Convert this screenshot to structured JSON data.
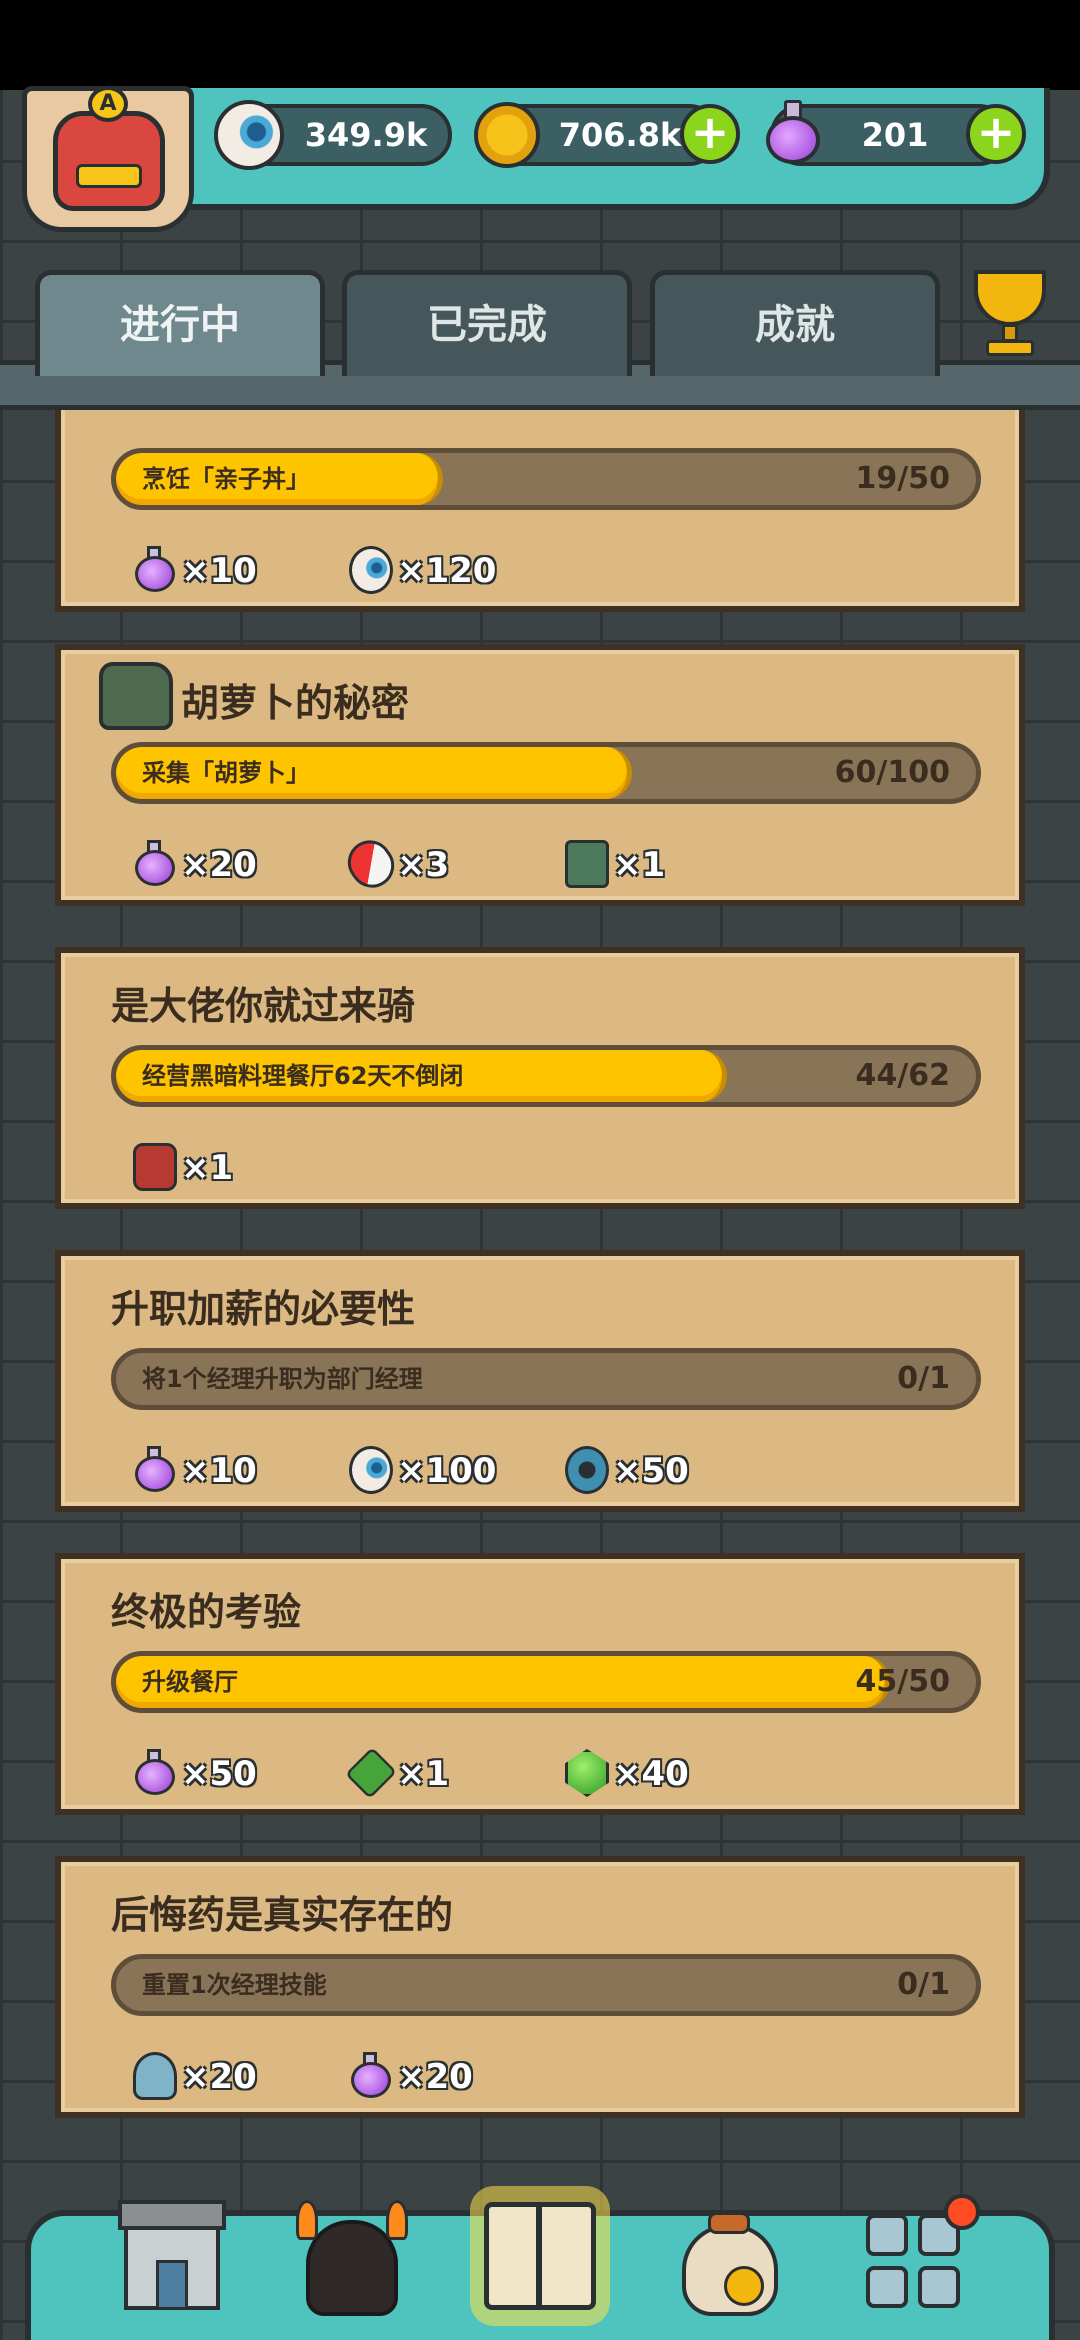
{
  "currency": {
    "eyes": "349.9k",
    "coins": "706.8k",
    "potions": "201",
    "add_symbol": "+"
  },
  "badge_letter": "A",
  "tabs": [
    {
      "label": "进行中",
      "active": true
    },
    {
      "label": "已完成",
      "active": false
    },
    {
      "label": "成就",
      "active": false
    }
  ],
  "quests": [
    {
      "title": "",
      "task": "烹饪「亲子丼」",
      "progress": "19/50",
      "fraction": 0.38,
      "rewards": [
        {
          "icon": "potion-icon",
          "qty": "×10"
        },
        {
          "icon": "eyeball-icon",
          "qty": "×120"
        }
      ]
    },
    {
      "title": "胡萝卜的秘密",
      "title_icon": "monster-card-icon",
      "task": "采集「胡萝卜」",
      "progress": "60/100",
      "fraction": 0.6,
      "rewards": [
        {
          "icon": "potion-icon",
          "qty": "×20"
        },
        {
          "icon": "pill-icon",
          "qty": "×3"
        },
        {
          "icon": "card-icon",
          "qty": "×1"
        }
      ]
    },
    {
      "title": "是大佬你就过来骑",
      "task": "经营黑暗料理餐厅62天不倒闭",
      "progress": "44/62",
      "fraction": 0.71,
      "rewards": [
        {
          "icon": "red-monster-icon",
          "qty": "×1"
        }
      ]
    },
    {
      "title": "升职加薪的必要性",
      "task": "将1个经理升职为部门经理",
      "progress": "0/1",
      "fraction": 0,
      "rewards": [
        {
          "icon": "potion-icon",
          "qty": "×10"
        },
        {
          "icon": "eyeball-icon",
          "qty": "×100"
        },
        {
          "icon": "gear-icon",
          "qty": "×50"
        }
      ]
    },
    {
      "title": "终极的考验",
      "task": "升级餐厅",
      "progress": "45/50",
      "fraction": 0.9,
      "rewards": [
        {
          "icon": "potion-icon",
          "qty": "×50"
        },
        {
          "icon": "green-monster-icon",
          "qty": "×1"
        },
        {
          "icon": "gem-icon",
          "qty": "×40"
        }
      ]
    },
    {
      "title": "后悔药是真实存在的",
      "task": "重置1次经理技能",
      "progress": "0/1",
      "fraction": 0,
      "rewards": [
        {
          "icon": "tool-icon",
          "qty": "×20"
        },
        {
          "icon": "potion-icon",
          "qty": "×20"
        }
      ]
    }
  ],
  "colors": {
    "bar_fill": "#ffc400",
    "card_bg": "#dcb982",
    "teal": "#4fc3bd",
    "plus_green": "#8bd61d"
  }
}
